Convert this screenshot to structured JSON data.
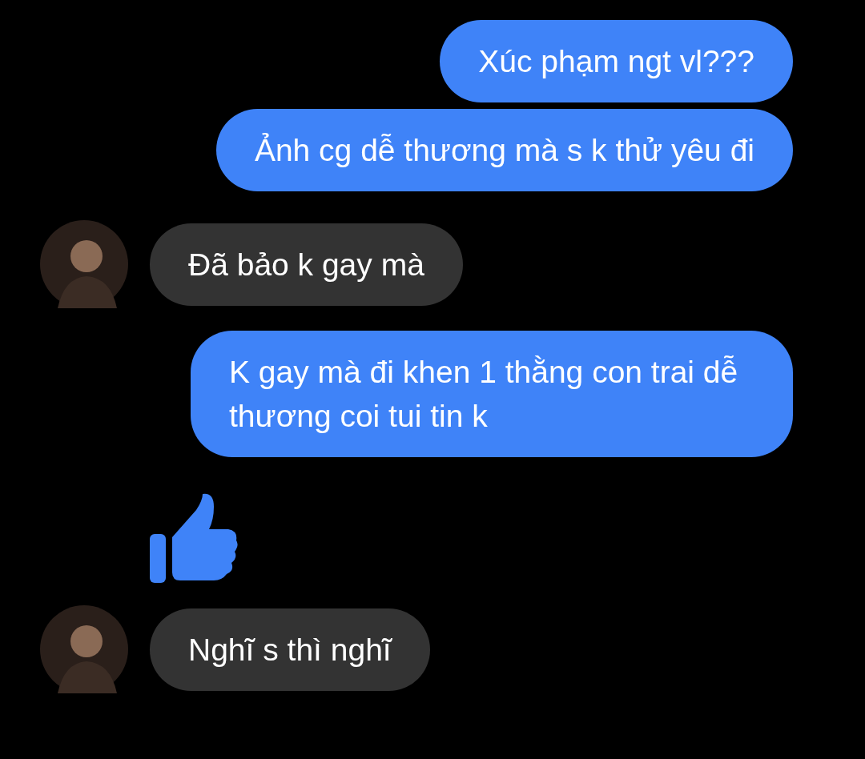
{
  "messages": [
    {
      "kind": "outgoing",
      "text": "Xúc phạm ngt vl???"
    },
    {
      "kind": "outgoing",
      "text": "Ảnh cg dễ thương mà s k thử yêu đi"
    },
    {
      "kind": "incoming",
      "text": "Đã bảo k gay mà"
    },
    {
      "kind": "outgoing",
      "text": "K gay mà đi khen 1 thằng con trai dễ thương coi tui tin k"
    },
    {
      "kind": "like"
    },
    {
      "kind": "incoming",
      "text": "Nghĩ s thì nghĩ"
    }
  ]
}
